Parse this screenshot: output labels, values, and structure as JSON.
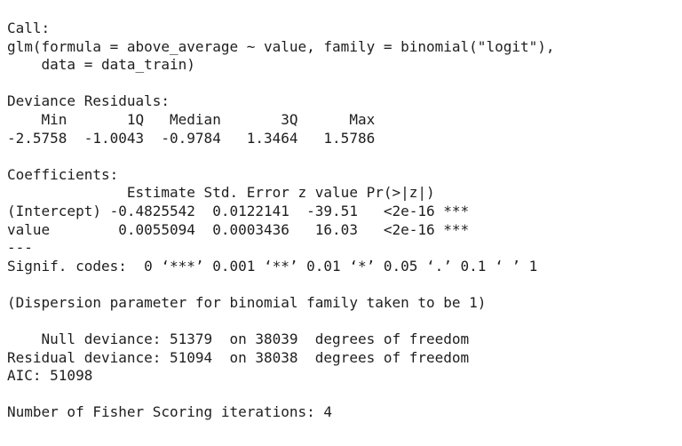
{
  "console": {
    "lines": [
      "Call:",
      "glm(formula = above_average ~ value, family = binomial(\"logit\"),",
      "    data = data_train)",
      "",
      "Deviance Residuals:",
      "    Min       1Q   Median       3Q      Max  ",
      "-2.5758  -1.0043  -0.9784   1.3464   1.5786  ",
      "",
      "Coefficients:",
      "              Estimate Std. Error z value Pr(>|z|)    ",
      "(Intercept) -0.4825542  0.0122141  -39.51   <2e-16 ***",
      "value        0.0055094  0.0003436   16.03   <2e-16 ***",
      "---",
      "Signif. codes:  0 ‘***’ 0.001 ‘**’ 0.01 ‘*’ 0.05 ‘.’ 0.1 ‘ ’ 1",
      "",
      "(Dispersion parameter for binomial family taken to be 1)",
      "",
      "    Null deviance: 51379  on 38039  degrees of freedom",
      "Residual deviance: 51094  on 38038  degrees of freedom",
      "AIC: 51098",
      "",
      "Number of Fisher Scoring iterations: 4"
    ]
  }
}
